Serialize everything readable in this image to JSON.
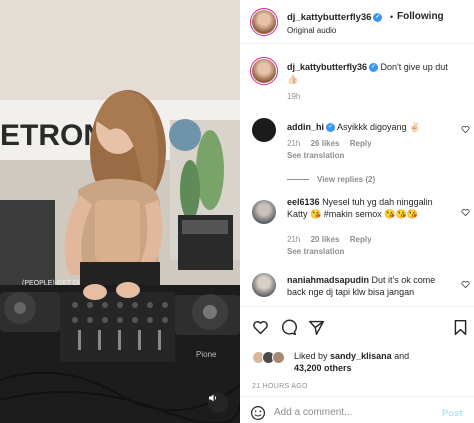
{
  "header": {
    "username": "dj_kattybutterfly36",
    "follow_label": "Following",
    "subtitle": "Original audio"
  },
  "caption": {
    "username": "dj_kattybutterfly36",
    "text": "Don't give up dut",
    "emoji": "👍🏻",
    "time": "19h"
  },
  "comments": [
    {
      "username": "addin_hi",
      "verified": true,
      "text": "Asyikkk digoyang",
      "emoji": "✌🏻",
      "time": "21h",
      "likes": "26 likes",
      "reply": "Reply",
      "see_translation": "See translation",
      "view_replies": "View replies (2)"
    },
    {
      "username": "eel6136",
      "text": "Nyesel tuh yg dah ninggalin Katty",
      "emoji_tag": "😘 #makin semox 😘😘😘",
      "time": "21h",
      "likes": "20 likes",
      "reply": "Reply",
      "see_translation": "See translation"
    },
    {
      "username": "naniahmadsapudin",
      "text": "Dut it's ok come back nge dj tapi klw bisa jangan"
    }
  ],
  "likes": {
    "prefix": "Liked by",
    "user": "sandy_klisana",
    "and": "and",
    "others": "43,200 others"
  },
  "time_ago": "21 HOURS AGO",
  "comment_box": {
    "placeholder": "Add a comment...",
    "post_label": "Post"
  },
  "media": {
    "background_sign": "ETRON",
    "sign_small": "(PEOPLE) GET DISCO",
    "deck_brand": "Pione"
  },
  "colors": {
    "verified": "#3897f0",
    "post_disabled": "#b2dffc",
    "secondary_text": "#8e8e8e",
    "primary_text": "#262626"
  },
  "icons": [
    "heart-icon",
    "comment-icon",
    "share-icon",
    "bookmark-icon",
    "emoji-icon",
    "mute-icon",
    "verified-icon"
  ]
}
